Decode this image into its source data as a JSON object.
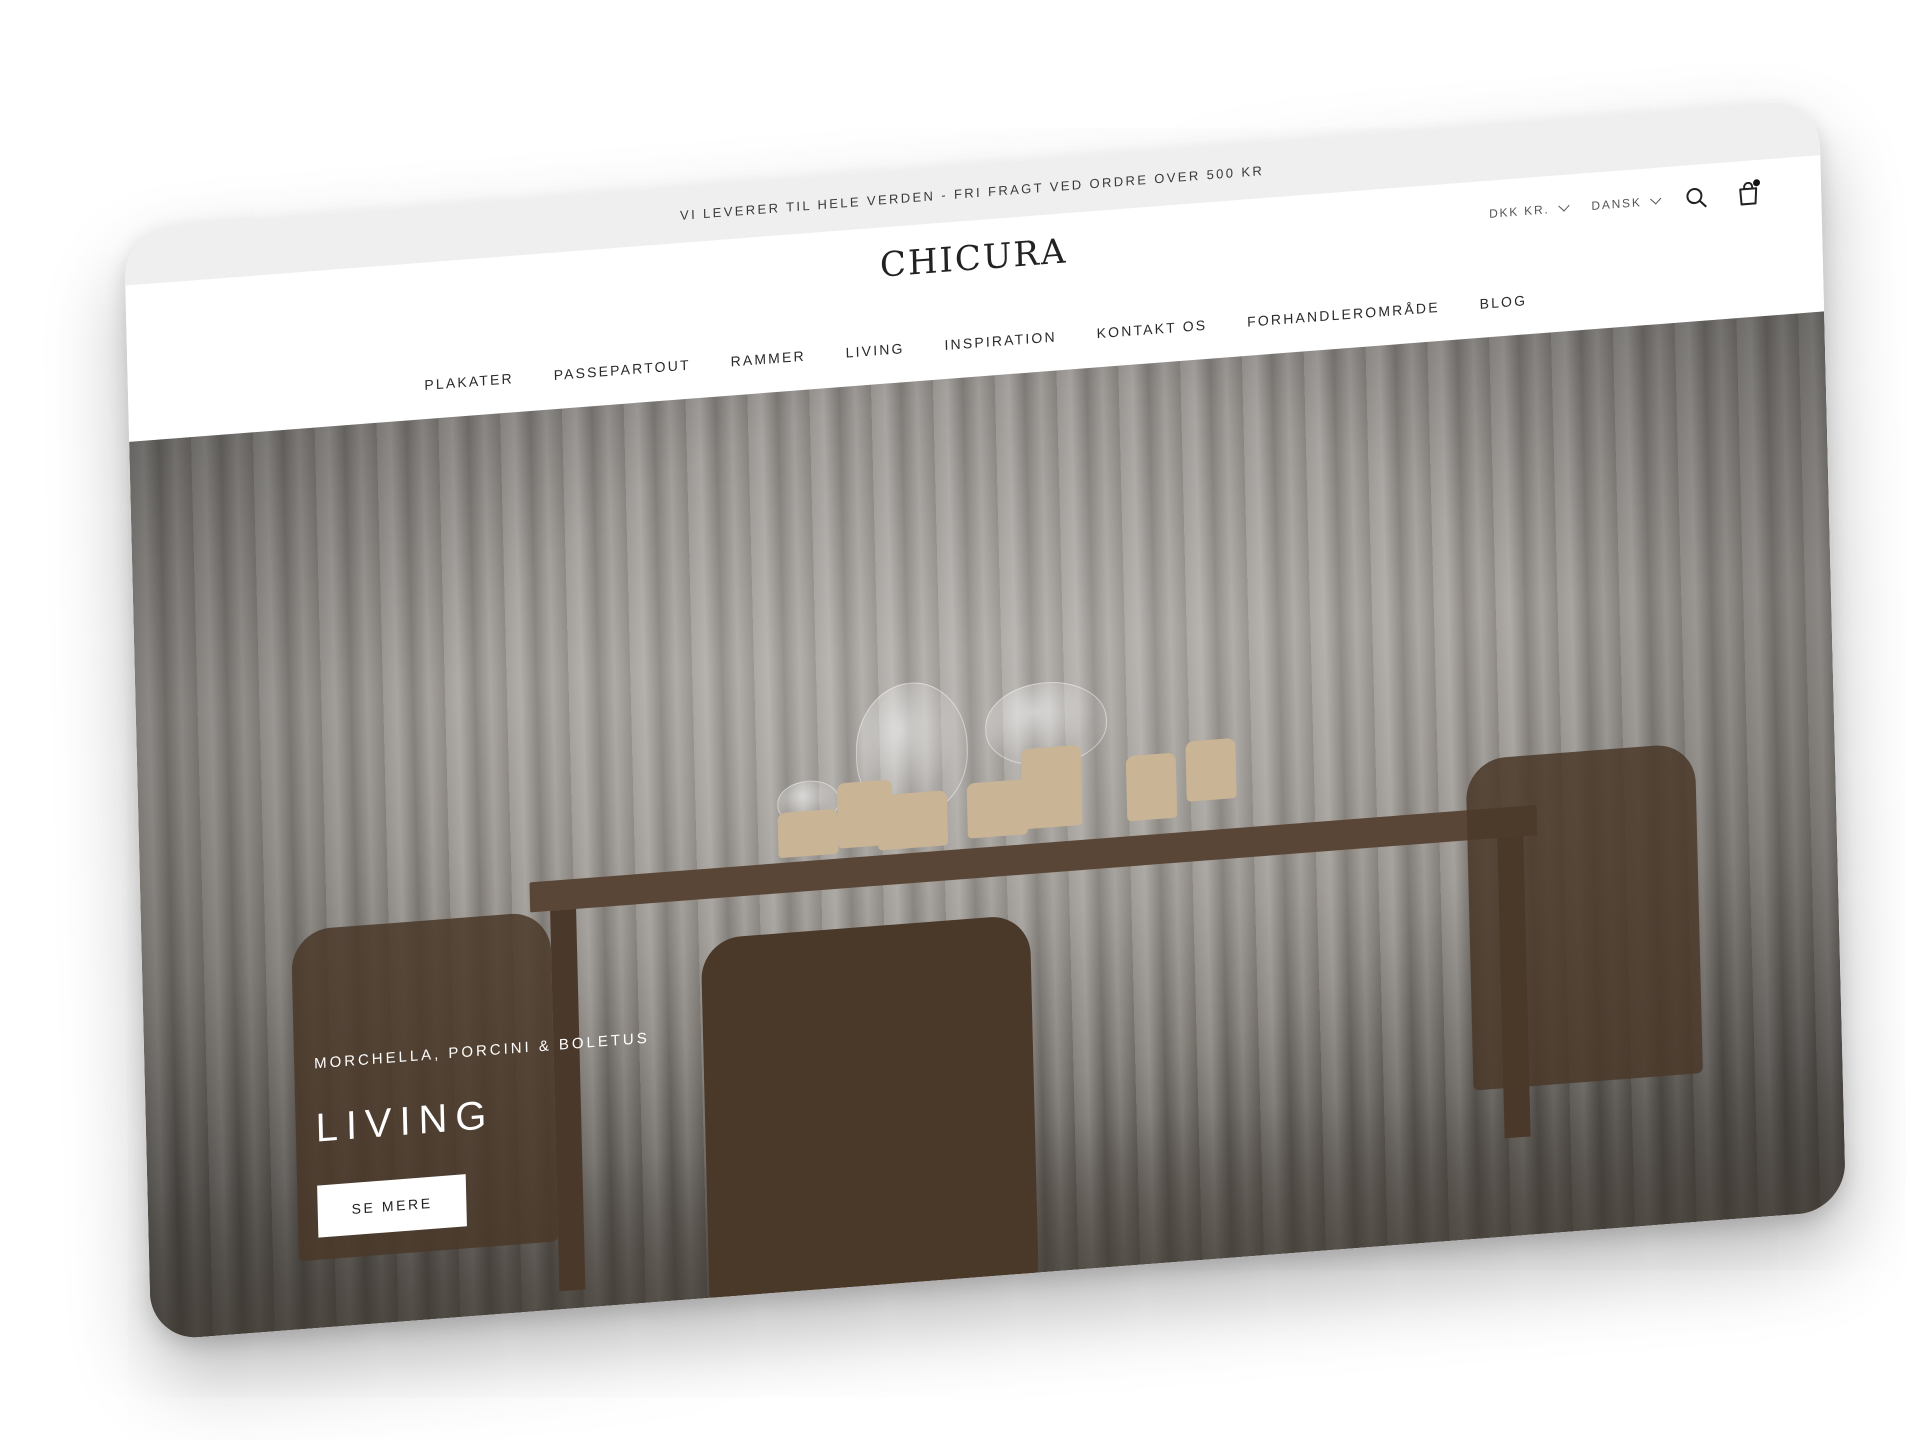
{
  "announcement": {
    "text": "VI LEVERER TIL HELE VERDEN - FRI FRAGT VED ORDRE OVER 500 KR"
  },
  "header": {
    "logo": "CHICURA",
    "currency": "DKK KR.",
    "language": "DANSK",
    "icons": {
      "search": "search-icon",
      "cart": "cart-icon"
    }
  },
  "nav": {
    "items": [
      {
        "label": "PLAKATER"
      },
      {
        "label": "PASSEPARTOUT"
      },
      {
        "label": "RAMMER"
      },
      {
        "label": "LIVING"
      },
      {
        "label": "INSPIRATION"
      },
      {
        "label": "KONTAKT OS"
      },
      {
        "label": "FORHANDLEROMRÅDE"
      },
      {
        "label": "BLOG"
      }
    ]
  },
  "hero": {
    "subtitle": "MORCHELLA, PORCINI & BOLETUS",
    "title": "LIVING",
    "button_label": "SE MERE"
  },
  "colors": {
    "announcement_bg": "#efefef",
    "text_dark": "#222222",
    "button_bg": "#ffffff"
  }
}
